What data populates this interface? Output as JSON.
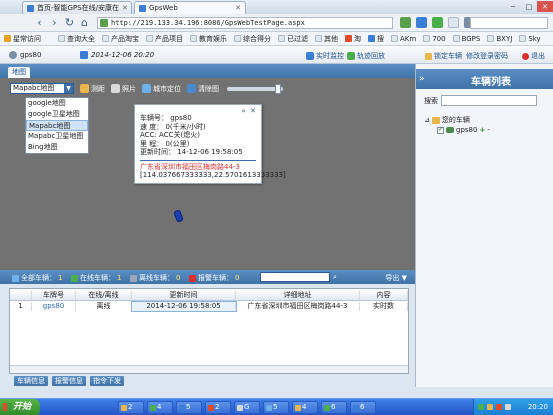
{
  "browser": {
    "tabs": [
      {
        "title": "首页-智能GPS在线/安康在"
      },
      {
        "title": "GpsWeb"
      }
    ],
    "url": "http://219.133.34.196:8086/GpsWebTestPage.aspx",
    "favorites": [
      "星常访问",
      "查询大全",
      "产品淘宝",
      "产品项目",
      "教育娱乐",
      "综合得分",
      "已过滤",
      "其他",
      "淘",
      "搜",
      "AKm",
      "700",
      "BGPS",
      "BXYJ",
      "Sky"
    ]
  },
  "app_header": {
    "user": "gps80",
    "date": "2014-12-06 20:20",
    "buttons": [
      "实时监控",
      "轨迹回放"
    ],
    "links": [
      "锁定车辆",
      "修改登录密码",
      "退出"
    ]
  },
  "map": {
    "tab_label": "地图",
    "select_value": "Mapabc地图",
    "map_types": [
      "google地图",
      "google卫星地图",
      "Mapabc地图",
      "Mapabc卫星地图",
      "Bing地图"
    ],
    "tools": [
      "测距",
      "照片",
      "城市定位",
      "清除图"
    ],
    "popup": {
      "rows": [
        "车辆号：  gps80",
        "速  度：  0(千米/小时)",
        "ACC: ACC关(熄火)",
        "里  程：  0(公里)",
        "更新时间：  14-12-06 19:58:05"
      ],
      "address": "广东省深圳市福田区梅岗路44-3",
      "coords": "[114.037667333333,22.5701613333333]"
    }
  },
  "status_bar": {
    "all": {
      "label": "全部车辆：",
      "count": "1"
    },
    "online": {
      "label": "在线车辆：",
      "count": "1"
    },
    "offline": {
      "label": "离线车辆：",
      "count": "0"
    },
    "alarm": {
      "label": "报警车辆：",
      "count": "0"
    },
    "export": "导出 ▼"
  },
  "table": {
    "columns": [
      "车牌号",
      "在线/离线",
      "更新时间",
      "详细地址",
      "内容"
    ],
    "rows": [
      {
        "index": "1",
        "plate": "gps80",
        "status": "离线",
        "time": "2014-12-06 19:58:05",
        "address": "广东省深圳市福田区梅岗路44-3",
        "content": "实时数"
      }
    ]
  },
  "bottom_tabs": [
    "车辆信息",
    "报警信息",
    "指令下发"
  ],
  "right_panel": {
    "title": "车辆列表",
    "search_label": "搜索",
    "group": "您的车辆",
    "vehicle": "gps80"
  },
  "taskbar": {
    "start": "开始",
    "items": [
      "2",
      "4",
      "5",
      "2",
      "G",
      "5",
      "4",
      "6",
      "6"
    ],
    "clock": "20:20"
  }
}
